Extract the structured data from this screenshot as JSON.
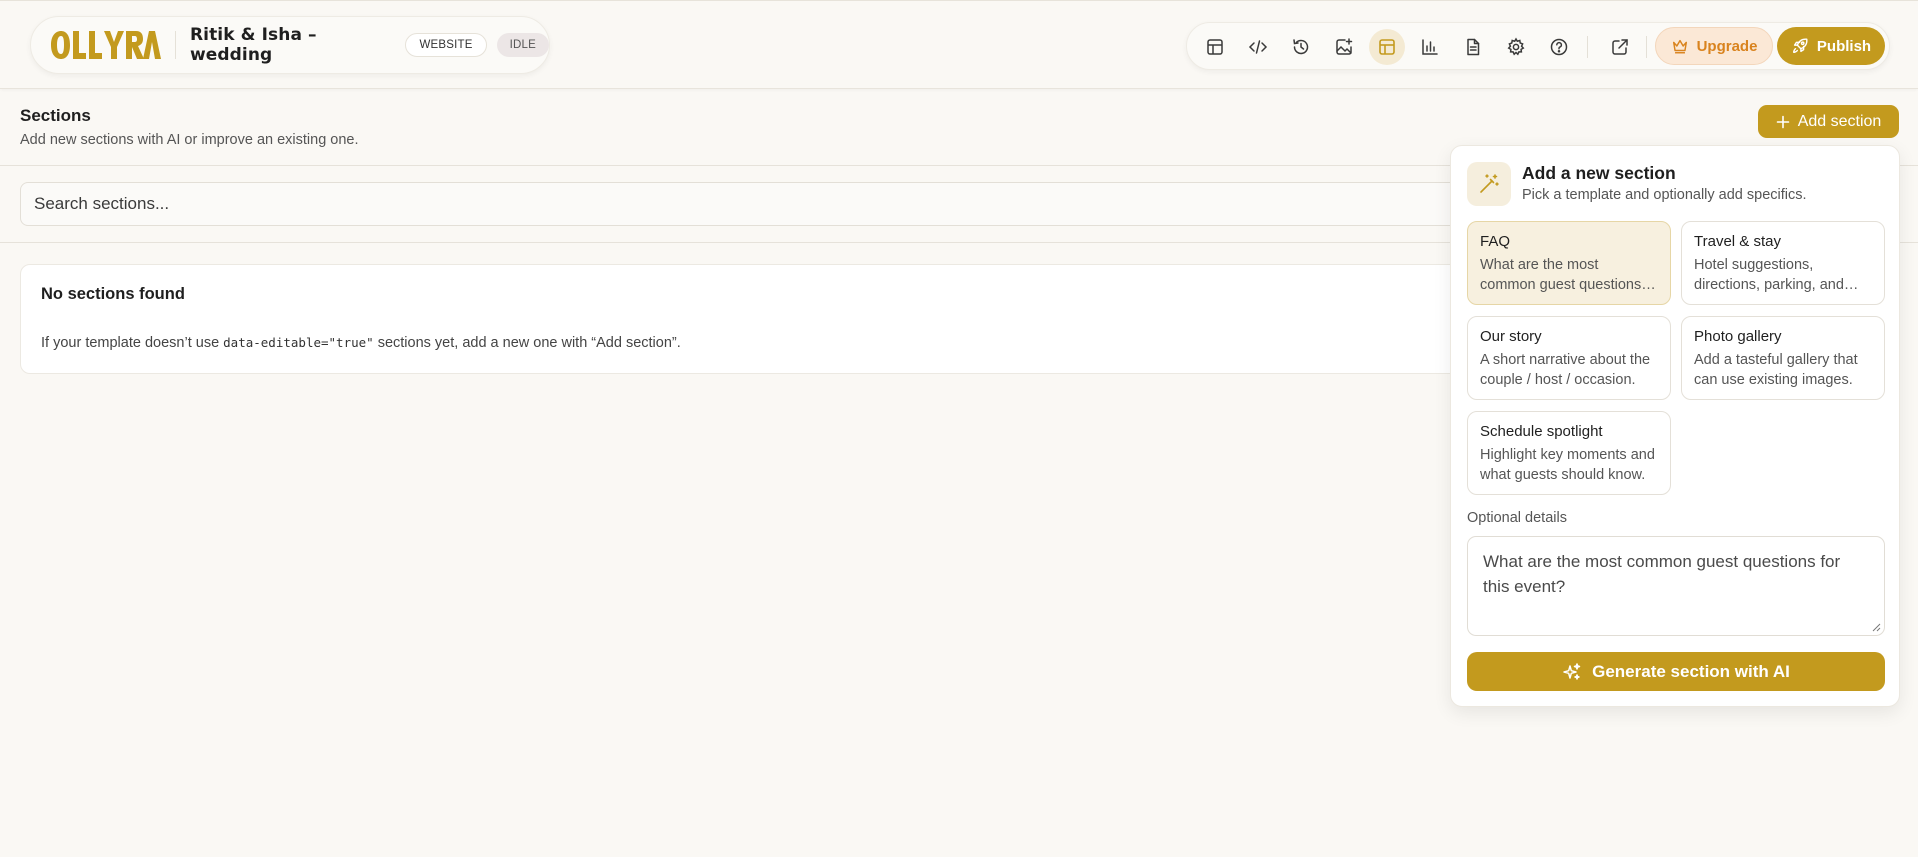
{
  "header": {
    "logo_text": "OLLYRA",
    "project_title": "Ritik & Isha – wedding",
    "type_badge": "WEBSITE",
    "status_badge": "IDLE",
    "toolbar": {
      "icons": [
        "layout-icon",
        "code-icon",
        "history-icon",
        "image-magic-icon",
        "sections-icon",
        "chart-icon",
        "document-icon",
        "gear-icon",
        "help-icon",
        "external-link-icon"
      ],
      "active_icon": "sections-icon",
      "upgrade_label": "Upgrade",
      "publish_label": "Publish"
    }
  },
  "sections_page": {
    "title": "Sections",
    "subtitle": "Add new sections with AI or improve an existing one.",
    "add_button_label": "Add section",
    "search_placeholder": "Search sections...",
    "empty_state": {
      "title": "No sections found",
      "desc_before": "If your template doesn’t use ",
      "desc_code": "data-editable=\"true\"",
      "desc_after": " sections yet, add a new one with “Add section”."
    }
  },
  "add_panel": {
    "title": "Add a new section",
    "subtitle": "Pick a template and optionally add specifics.",
    "templates": [
      {
        "name": "FAQ",
        "description": "What are the most common guest questions for this event?",
        "selected": true
      },
      {
        "name": "Travel & stay",
        "description": "Hotel suggestions, directions, parking, and local tips.",
        "selected": false
      },
      {
        "name": "Our story",
        "description": "A short narrative about the couple / host / occasion.",
        "selected": false
      },
      {
        "name": "Photo gallery",
        "description": "Add a tasteful gallery that can use existing images.",
        "selected": false
      },
      {
        "name": "Schedule spotlight",
        "description": "Highlight key moments and what guests should know.",
        "selected": false
      }
    ],
    "optional_label": "Optional details",
    "optional_value": "What are the most common guest questions for this event?",
    "generate_label": "Generate section with AI"
  },
  "colors": {
    "accent": "#c39a1e",
    "background": "#faf8f4",
    "upgrade_text": "#d9831e"
  }
}
